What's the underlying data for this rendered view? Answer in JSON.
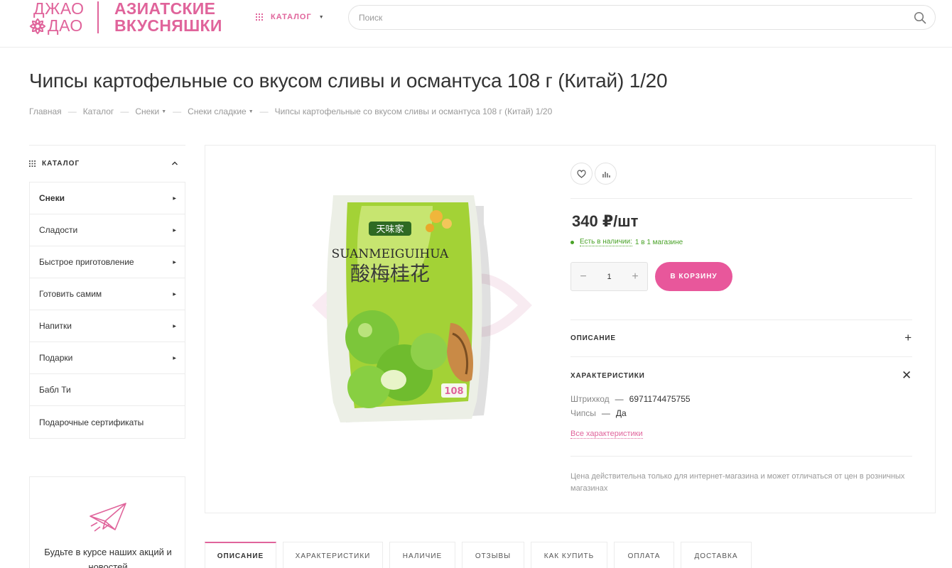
{
  "header": {
    "logo": {
      "line1": "ДЖАО",
      "line2": "ДАО",
      "right1": "АЗИАТСКИЕ",
      "right2": "ВКУСНЯШКИ"
    },
    "catalog_label": "КАТАЛОГ",
    "search_placeholder": "Поиск",
    "search_value": ""
  },
  "page": {
    "title": "Чипсы картофельные со вкусом сливы и османтуса 108 г (Китай) 1/20"
  },
  "breadcrumb": [
    {
      "label": "Главная",
      "has_dropdown": false
    },
    {
      "label": "Каталог",
      "has_dropdown": false
    },
    {
      "label": "Снеки",
      "has_dropdown": true
    },
    {
      "label": "Снеки сладкие",
      "has_dropdown": true
    },
    {
      "label": "Чипсы картофельные со вкусом сливы и османтуса 108 г (Китай) 1/20",
      "has_dropdown": false
    }
  ],
  "sidebar": {
    "title": "КАТАЛОГ",
    "items": [
      {
        "label": "Снеки",
        "active": true,
        "has_arrow": true
      },
      {
        "label": "Сладости",
        "active": false,
        "has_arrow": true
      },
      {
        "label": "Быстрое приготовление",
        "active": false,
        "has_arrow": true
      },
      {
        "label": "Готовить самим",
        "active": false,
        "has_arrow": true
      },
      {
        "label": "Напитки",
        "active": false,
        "has_arrow": true
      },
      {
        "label": "Подарки",
        "active": false,
        "has_arrow": true
      },
      {
        "label": "Бабл Ти",
        "active": false,
        "has_arrow": false
      },
      {
        "label": "Подарочные сертификаты",
        "active": false,
        "has_arrow": false
      }
    ],
    "promo_text": "Будьте в курсе наших акций и новостей"
  },
  "product": {
    "price": "340 ₽/шт",
    "stock_label": "Есть в наличии:",
    "stock_detail": "1 в 1 магазине",
    "quantity": "1",
    "cart_button": "В КОРЗИНУ",
    "description_label": "ОПИСАНИЕ",
    "specs_label": "ХАРАКТЕРИСТИКИ",
    "specs": [
      {
        "key": "Штрихкод",
        "value": "6971174475755"
      },
      {
        "key": "Чипсы",
        "value": "Да"
      }
    ],
    "all_specs_link": "Все характеристики",
    "note": "Цена действительна только для интернет-магазина и может отличаться от цен в розничных магазинах",
    "package_text": {
      "brand": "天味家",
      "latin": "SUANMEIGUIHUA",
      "chinese": "酸梅桂花",
      "weight": "108"
    }
  },
  "tabs": [
    {
      "label": "ОПИСАНИЕ",
      "active": true
    },
    {
      "label": "ХАРАКТЕРИСТИКИ",
      "active": false
    },
    {
      "label": "НАЛИЧИЕ",
      "active": false
    },
    {
      "label": "ОТЗЫВЫ",
      "active": false
    },
    {
      "label": "КАК КУПИТЬ",
      "active": false
    },
    {
      "label": "ОПЛАТА",
      "active": false
    },
    {
      "label": "ДОСТАВКА",
      "active": false
    }
  ],
  "colors": {
    "accent": "#e0649b",
    "button": "#e8579b",
    "stock_green": "#49a227",
    "border": "#ececec"
  }
}
